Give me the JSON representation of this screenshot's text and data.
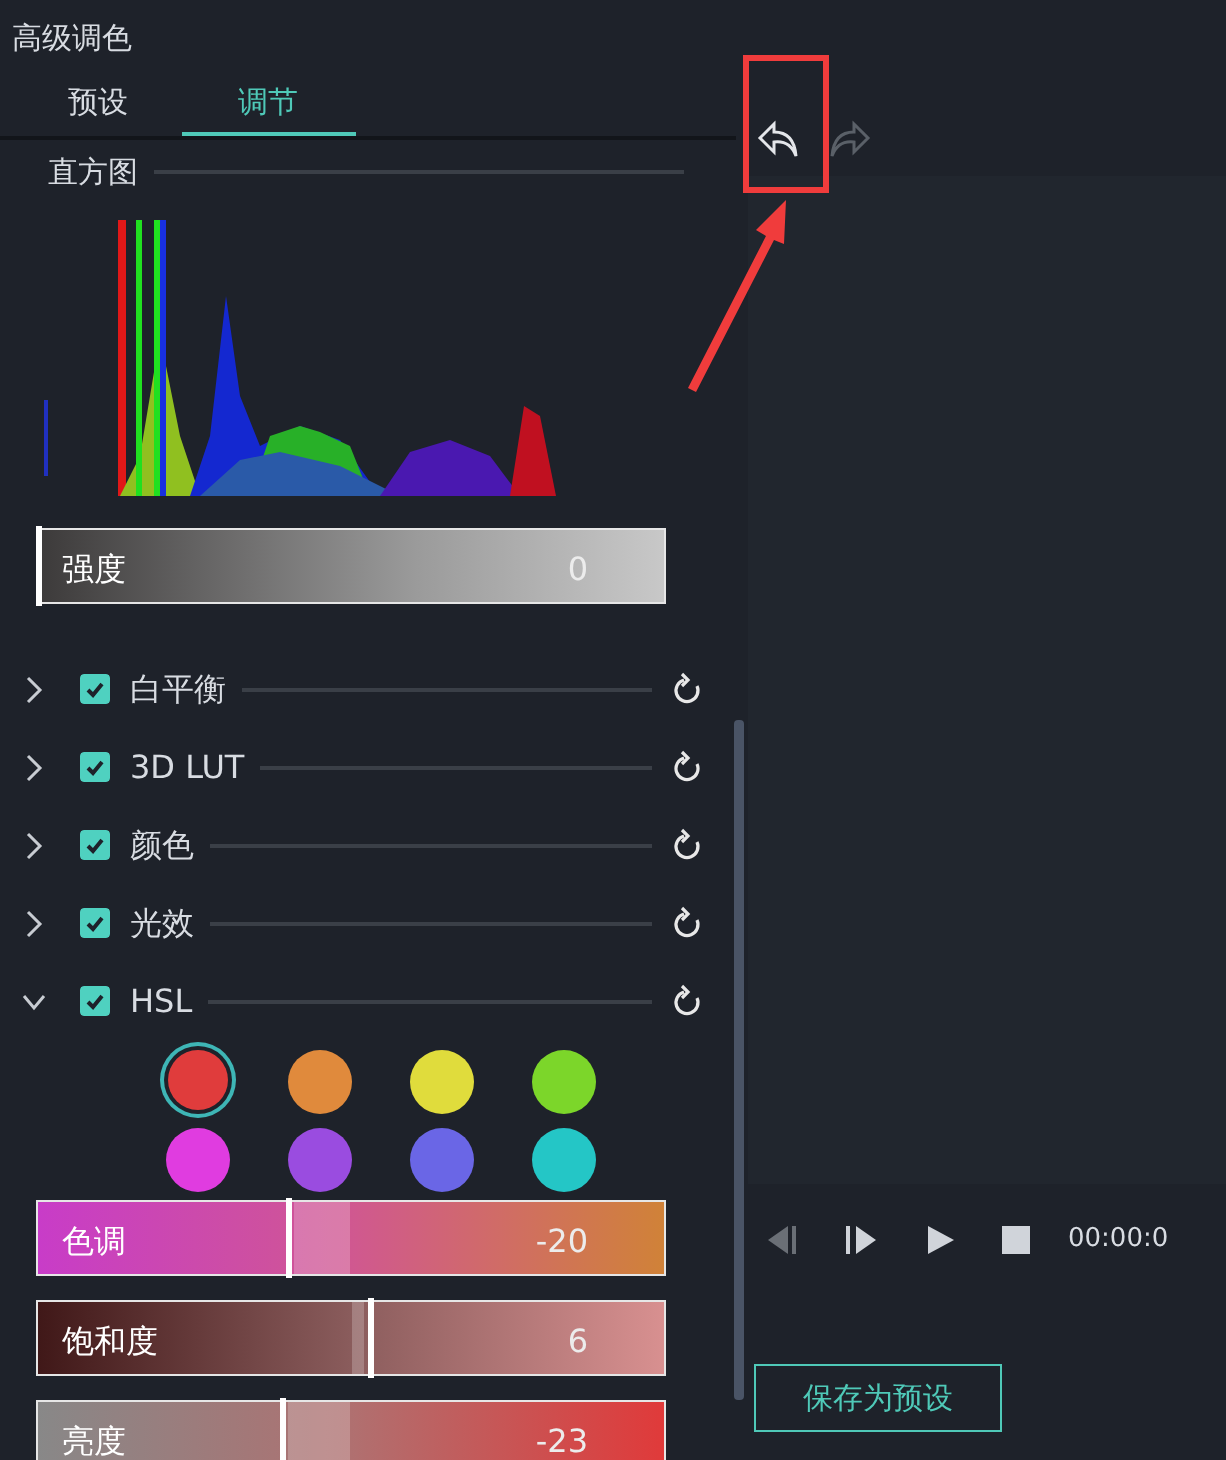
{
  "title": "高级调色",
  "tabs": [
    {
      "label": "预设",
      "selected": false
    },
    {
      "label": "调节",
      "selected": true
    }
  ],
  "histogram": {
    "label": "直方图"
  },
  "strength": {
    "label": "强度",
    "value": "0",
    "level": 0
  },
  "sections": [
    {
      "label": "白平衡",
      "checked": true,
      "expanded": false
    },
    {
      "label": "3D LUT",
      "checked": true,
      "expanded": false
    },
    {
      "label": "颜色",
      "checked": true,
      "expanded": false
    },
    {
      "label": "光效",
      "checked": true,
      "expanded": false
    },
    {
      "label": "HSL",
      "checked": true,
      "expanded": true
    }
  ],
  "hsl_colors": [
    {
      "color": "#e03c3c",
      "selected": true
    },
    {
      "color": "#e08a3c",
      "selected": false
    },
    {
      "color": "#e0dc3c",
      "selected": false
    },
    {
      "color": "#7cd62a",
      "selected": false
    },
    {
      "color": "#e03ce0",
      "selected": false
    },
    {
      "color": "#9a4ce0",
      "selected": false
    },
    {
      "color": "#6a66e6",
      "selected": false
    },
    {
      "color": "#24c6c6",
      "selected": false
    }
  ],
  "hsl_sliders": [
    {
      "kind": "hue",
      "label": "色调",
      "value": "-20",
      "level": 0.4
    },
    {
      "kind": "saturation",
      "label": "饱和度",
      "value": "6",
      "level": 0.53
    },
    {
      "kind": "luminance",
      "label": "亮度",
      "value": "-23",
      "level": 0.39
    }
  ],
  "toolbar": [
    {
      "kind": "undo",
      "disabled": false
    },
    {
      "kind": "redo",
      "disabled": true
    }
  ],
  "playback": {
    "time": "00:00:0"
  },
  "save_button": "保存为预设",
  "annotation": {
    "highlight_box": true,
    "arrow": true
  }
}
